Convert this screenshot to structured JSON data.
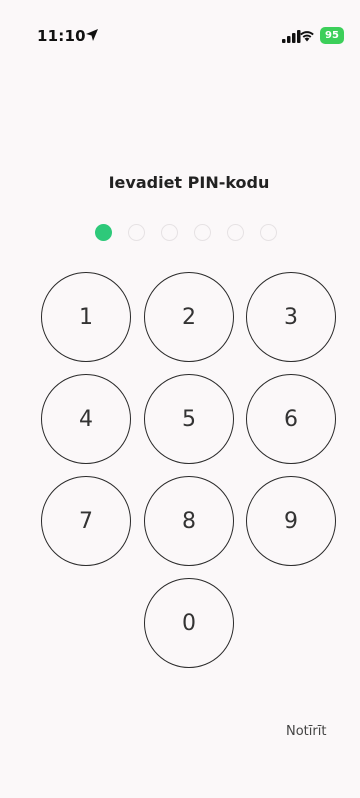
{
  "status_bar": {
    "time": "11:10",
    "battery": "95"
  },
  "title": "Ievadiet PIN-kodu",
  "pin": {
    "length": 6,
    "entered": 1,
    "filled_color": "#2ec97a"
  },
  "keypad": {
    "keys": [
      "1",
      "2",
      "3",
      "4",
      "5",
      "6",
      "7",
      "8",
      "9",
      "0"
    ]
  },
  "clear_label": "Notīrīt"
}
